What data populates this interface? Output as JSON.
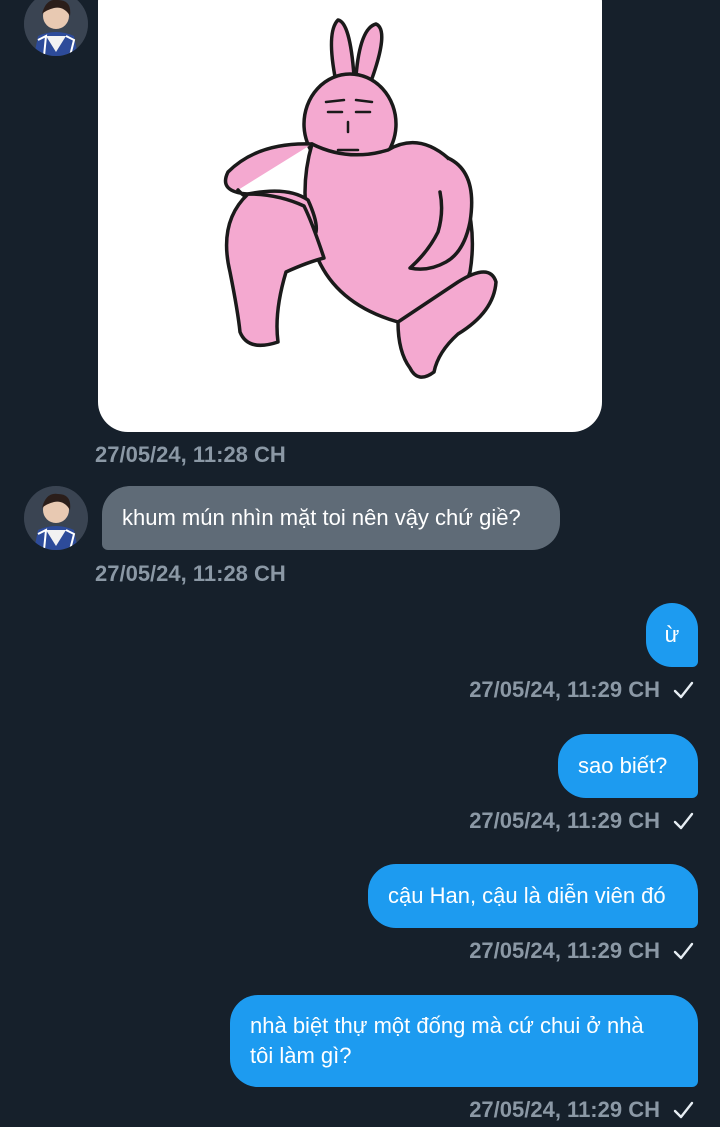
{
  "messages": [
    {
      "type": "image",
      "sender": "other",
      "timestamp": "27/05/24, 11:28 CH",
      "image_desc": "pink rabbit sticker"
    },
    {
      "type": "text",
      "sender": "other",
      "text": "khum mún nhìn mặt toi nên vậy chứ giề?",
      "timestamp": "27/05/24, 11:28 CH"
    },
    {
      "type": "text",
      "sender": "me",
      "text": "ừ",
      "timestamp": "27/05/24, 11:29 CH",
      "status_icon": "check-icon"
    },
    {
      "type": "text",
      "sender": "me",
      "text": "sao biết?",
      "timestamp": "27/05/24, 11:29 CH",
      "status_icon": "check-icon"
    },
    {
      "type": "text",
      "sender": "me",
      "text": "cậu Han, cậu là diễn viên đó",
      "timestamp": "27/05/24, 11:29 CH",
      "status_icon": "check-icon"
    },
    {
      "type": "text",
      "sender": "me",
      "text": "nhà biệt thự một đống mà cứ chui ở nhà\ntôi làm gì?",
      "timestamp": "27/05/24, 11:29 CH",
      "status_icon": "check-icon"
    }
  ],
  "colors": {
    "background": "#16202b",
    "received_bubble": "#5f6b77",
    "sent_bubble": "#1d9bf0",
    "timestamp": "#8b98a5"
  }
}
